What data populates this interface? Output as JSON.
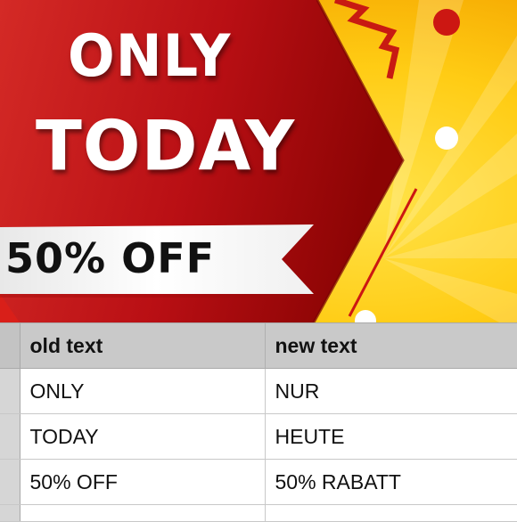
{
  "banner": {
    "headline_line1": "ONLY",
    "headline_line2": "TODAY",
    "discount": "50% OFF",
    "colors": {
      "red": "#c8151b",
      "dark_red": "#8f0606",
      "yellow": "#ffd21a",
      "orange": "#f6a800",
      "ribbon": "#f2f2f2"
    }
  },
  "sheet": {
    "headers": [
      "old text",
      "new text"
    ],
    "rows": [
      [
        "ONLY",
        "NUR"
      ],
      [
        "TODAY",
        "HEUTE"
      ],
      [
        "50% OFF",
        "50% RABATT"
      ]
    ]
  }
}
